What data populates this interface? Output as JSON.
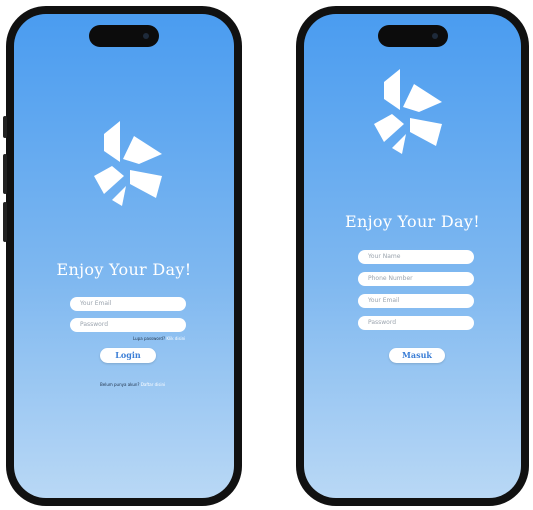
{
  "login_screen": {
    "tagline": "Enjoy Your Day!",
    "email_placeholder": "Your Email",
    "password_placeholder": "Password",
    "forgot_text": "Lupa password?",
    "forgot_link": "Klik disini",
    "login_button": "Login",
    "register_text": "Belum punya akun?",
    "register_link": "Daftar disini"
  },
  "register_screen": {
    "tagline": "Enjoy Your Day!",
    "name_placeholder": "Your Name",
    "phone_placeholder": "Phone Number",
    "email_placeholder": "Your Email",
    "password_placeholder": "Password",
    "submit_button": "Masuk"
  },
  "colors": {
    "background_top": "#4a9cf0",
    "background_bottom": "#b9d8f5",
    "accent_text": "#3b7ed6"
  },
  "icons": [
    "app-logo-icon"
  ]
}
